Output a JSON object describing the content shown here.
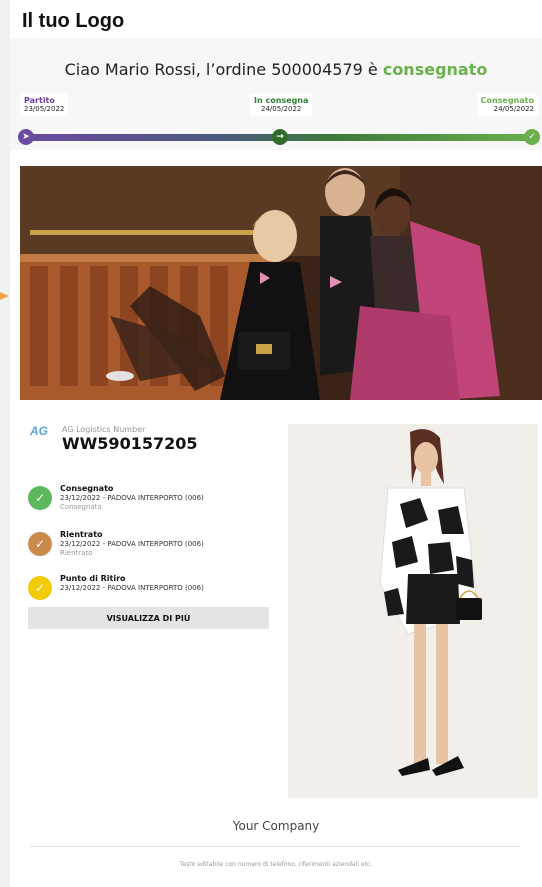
{
  "header": {
    "logo_text": "Il tuo Logo"
  },
  "greeting": {
    "prefix": "Ciao Mario Rossi, l’ordine 500004579 è ",
    "status": "consegnato"
  },
  "progress": {
    "steps": [
      {
        "name": "Partito",
        "date": "23/05/2022"
      },
      {
        "name": "In consegna",
        "date": "24/05/2022"
      },
      {
        "name": "Consegnato",
        "date": "24/05/2022"
      }
    ],
    "fraction": 1.0
  },
  "tracking": {
    "logo_text": "AG",
    "label": "AG Logistics Number",
    "number": "WW590157205"
  },
  "events": [
    {
      "title": "Consegnato",
      "detail": "23/12/2022 - PADOVA INTERPORTO (006)",
      "note": "Consegnata",
      "color": "#5cb85c"
    },
    {
      "title": "Rientrato",
      "detail": "23/12/2022 - PADOVA INTERPORTO (006)",
      "note": "Rientrato",
      "color": "#c98a4b"
    },
    {
      "title": "Punto di Ritiro",
      "detail": "23/12/2022 - PADOVA INTERPORTO (006)",
      "note": "",
      "color": "#f2cc0c"
    }
  ],
  "more_button": "VISUALIZZA DI PIÙ",
  "footer": {
    "company": "Your Company",
    "text": "Testo editabile con numero di telefono, riferimenti aziendali etc."
  },
  "colors": {
    "accent_green": "#6ab04c",
    "accent_purple": "#6a3d9a",
    "accent_orange": "#f5a04a"
  }
}
